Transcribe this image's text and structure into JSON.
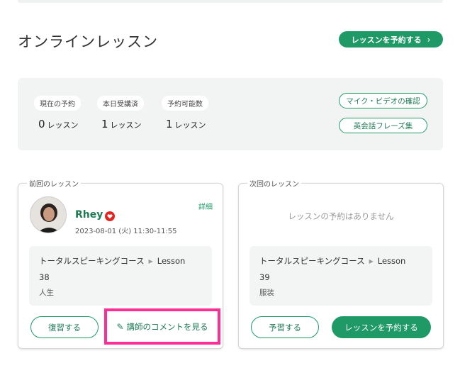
{
  "page": {
    "title": "オンラインレッスン",
    "reserve_label": "レッスンを予約する",
    "reserve_chevron": "›"
  },
  "stats": [
    {
      "label": "現在の予約",
      "value": "0",
      "unit": "レッスン"
    },
    {
      "label": "本日受講済",
      "value": "1",
      "unit": "レッスン"
    },
    {
      "label": "予約可能数",
      "value": "1",
      "unit": "レッスン"
    }
  ],
  "links": {
    "mic_check": "マイク・ビデオの確認",
    "phrases": "英会話フレーズ集"
  },
  "previous": {
    "legend": "前回のレッスン",
    "tutor_name": "Rhey",
    "time": "2023-08-01 (火) 11:30-11:55",
    "detail": "詳細",
    "course": "トータルスピーキングコース",
    "lesson_label": "Lesson",
    "lesson_no": "38",
    "topic": "人生",
    "review_label": "復習する",
    "comment_label": "講師のコメントを見る"
  },
  "next": {
    "legend": "次回のレッスン",
    "empty": "レッスンの予約はありません",
    "course": "トータルスピーキングコース",
    "lesson_label": "Lesson",
    "lesson_no": "39",
    "topic": "服装",
    "prep_label": "予習する",
    "reserve_label": "レッスンを予約する"
  },
  "colors": {
    "accent": "#1f9a67",
    "highlight": "#ff2d96",
    "heart": "#e0261f"
  },
  "icons": {
    "heart": "heart-icon",
    "pencil": "pencil-icon",
    "arrow": "triangle-right-icon"
  }
}
